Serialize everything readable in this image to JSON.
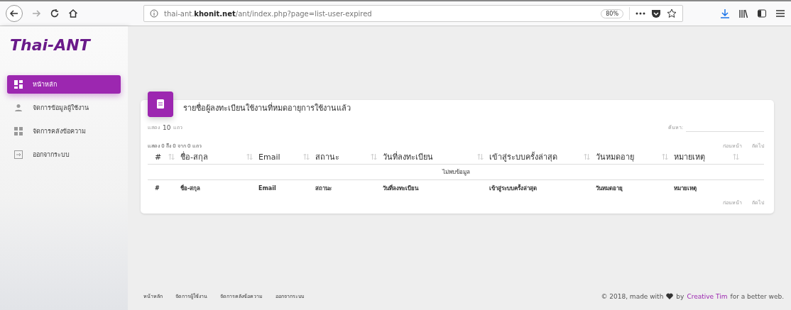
{
  "browser": {
    "url": "thai-ant.**khonit.net**/ant/index.php?page=list-user-expired",
    "zoom": "80%"
  },
  "sidebar": {
    "logo": "Thai-ANT",
    "items": [
      {
        "label": "หน้าหลัก",
        "selected": true
      },
      {
        "label": "จัดการข้อมูลผู้ใช้งาน",
        "selected": false
      },
      {
        "label": "จัดการคลังข้อความ",
        "selected": false
      },
      {
        "label": "ออกจากระบบ",
        "selected": false
      }
    ]
  },
  "card": {
    "title": "รายชื่อผู้ลงทะเบียนใช้งานที่หมดอายุการใช้งานแล้ว",
    "length": {
      "before": "แสดง",
      "value": "10",
      "after": "แถว"
    },
    "search_label": "ค้นหา:",
    "info": "แสดง 0 ถึง 0 จาก 0 แถว",
    "pager_top": [
      "ก่อนหน้า",
      "ถัดไป"
    ],
    "columns": [
      "#",
      "ชื่อ-สกุล",
      "Email",
      "สถานะ",
      "วันที่ลงทะเบียน",
      "เข้าสู่ระบบครั้งล่าสุด",
      "วันหมดอายุ",
      "หมายเหตุ"
    ],
    "empty": "ไม่พบข้อมูล",
    "footer_columns": [
      "#",
      "ชื่อ-สกุล",
      "Email",
      "สถานะ",
      "วันที่ลงทะเบียน",
      "เข้าสู่ระบบครั้งล่าสุด",
      "วันหมดอายุ",
      "หมายเหตุ"
    ],
    "pager_bottom": [
      "ก่อนหน้า",
      "ถัดไป"
    ]
  },
  "footer": {
    "links": [
      "หน้าหลัก",
      "จัดการผู้ใช้งาน",
      "จัดการคลังข้อความ",
      "ออกจากระบบ"
    ],
    "credit": {
      "before": "© 2018, made with",
      "middle": "by",
      "link": "Creative Tim",
      "after": "for a better web."
    }
  }
}
